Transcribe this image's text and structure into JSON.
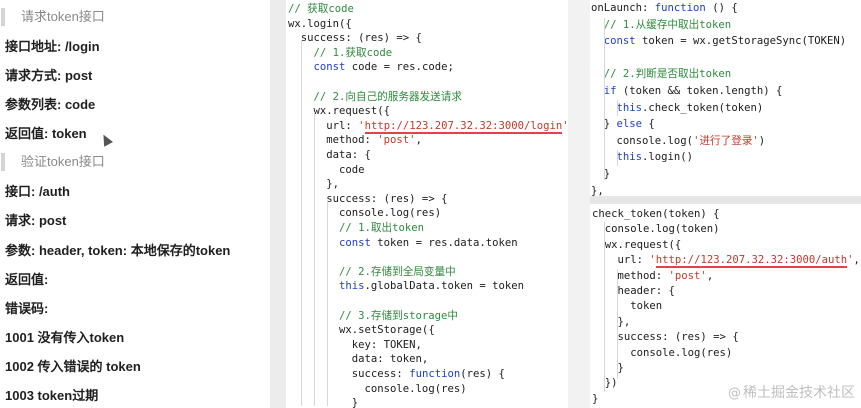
{
  "doc": {
    "lines": [
      {
        "text": "请求token接口",
        "kind": "section"
      },
      {
        "text": "接口地址: /login",
        "kind": "field"
      },
      {
        "text": "请求方式: post",
        "kind": "field"
      },
      {
        "text": "参数列表: code",
        "kind": "field"
      },
      {
        "text": "返回值: token",
        "kind": "field"
      },
      {
        "text": "验证token接口",
        "kind": "section"
      },
      {
        "text": "接口: /auth",
        "kind": "field"
      },
      {
        "text": "请求: post",
        "kind": "field"
      },
      {
        "text": "参数: header, token: 本地保存的token",
        "kind": "field"
      },
      {
        "text": "返回值:",
        "kind": "field"
      },
      {
        "text": "错误码:",
        "kind": "field"
      },
      {
        "text": "1001 没有传入token",
        "kind": "field"
      },
      {
        "text": "1002 传入错误的 token",
        "kind": "field"
      },
      {
        "text": "1003 token过期",
        "kind": "field"
      }
    ]
  },
  "code_login": {
    "lines": [
      [
        [
          "c",
          "// 获取code"
        ]
      ],
      [
        [
          "p",
          "wx.login({"
        ]
      ],
      [
        [
          "p",
          "  success: (res) => {"
        ]
      ],
      [
        [
          "c",
          "    // 1.获取code"
        ]
      ],
      [
        [
          "k",
          "    const "
        ],
        [
          "p",
          "code = res.code;"
        ]
      ],
      [
        [
          "p",
          ""
        ]
      ],
      [
        [
          "c",
          "    // 2.向自己的服务器发送请求"
        ]
      ],
      [
        [
          "p",
          "    wx.request({"
        ]
      ],
      [
        [
          "p",
          "      url: "
        ],
        [
          "s",
          "'"
        ],
        [
          "u",
          "http://123.207.32.32:3000/login"
        ],
        [
          "s",
          "'"
        ],
        [
          "p",
          ","
        ]
      ],
      [
        [
          "p",
          "      method: "
        ],
        [
          "s",
          "'post'"
        ],
        [
          "p",
          ","
        ]
      ],
      [
        [
          "p",
          "      data: {"
        ]
      ],
      [
        [
          "p",
          "        code"
        ]
      ],
      [
        [
          "p",
          "      },"
        ]
      ],
      [
        [
          "p",
          "      success: (res) => {"
        ]
      ],
      [
        [
          "p",
          "        console.log(res)"
        ]
      ],
      [
        [
          "c",
          "        // 1.取出token"
        ]
      ],
      [
        [
          "k",
          "        const "
        ],
        [
          "p",
          "token = res.data.token"
        ]
      ],
      [
        [
          "p",
          ""
        ]
      ],
      [
        [
          "c",
          "        // 2.存储到全局变量中"
        ]
      ],
      [
        [
          "k",
          "        this"
        ],
        [
          "p",
          ".globalData.token = token"
        ]
      ],
      [
        [
          "p",
          ""
        ]
      ],
      [
        [
          "c",
          "        // 3.存储到storage中"
        ]
      ],
      [
        [
          "p",
          "        wx.setStorage({"
        ]
      ],
      [
        [
          "p",
          "          key: TOKEN,"
        ]
      ],
      [
        [
          "p",
          "          data: token,"
        ]
      ],
      [
        [
          "p",
          "          success: "
        ],
        [
          "k",
          "function"
        ],
        [
          "p",
          "(res) {"
        ]
      ],
      [
        [
          "p",
          "            console.log(res)"
        ]
      ],
      [
        [
          "p",
          "          }"
        ]
      ]
    ]
  },
  "code_launch": {
    "lines": [
      [
        [
          "p",
          "onLaunch: "
        ],
        [
          "k",
          "function"
        ],
        [
          "p",
          " () {"
        ]
      ],
      [
        [
          "c",
          "  // 1.从缓存中取出token"
        ]
      ],
      [
        [
          "k",
          "  const "
        ],
        [
          "p",
          "token = wx.getStorageSync(TOKEN)"
        ]
      ],
      [
        [
          "p",
          ""
        ]
      ],
      [
        [
          "c",
          "  // 2.判断是否取出token"
        ]
      ],
      [
        [
          "k",
          "  if "
        ],
        [
          "p",
          "(token && token.length) {"
        ]
      ],
      [
        [
          "k",
          "    this"
        ],
        [
          "p",
          ".check_token(token)"
        ]
      ],
      [
        [
          "p",
          "  } "
        ],
        [
          "k",
          "else"
        ],
        [
          "p",
          " {"
        ]
      ],
      [
        [
          "p",
          "    console.log("
        ],
        [
          "s",
          "'进行了登录'"
        ],
        [
          "p",
          ")"
        ]
      ],
      [
        [
          "k",
          "    this"
        ],
        [
          "p",
          ".login()"
        ]
      ],
      [
        [
          "p",
          "  }"
        ]
      ],
      [
        [
          "p",
          "},"
        ]
      ]
    ]
  },
  "code_check": {
    "lines": [
      [
        [
          "p",
          "check_token(token) {"
        ]
      ],
      [
        [
          "p",
          "  console.log(token)"
        ]
      ],
      [
        [
          "p",
          "  wx.request({"
        ]
      ],
      [
        [
          "p",
          "    url: "
        ],
        [
          "s",
          "'"
        ],
        [
          "u",
          "http://123.207.32.32:3000/auth"
        ],
        [
          "s",
          "'"
        ],
        [
          "p",
          ","
        ]
      ],
      [
        [
          "p",
          "    method: "
        ],
        [
          "s",
          "'post'"
        ],
        [
          "p",
          ","
        ]
      ],
      [
        [
          "p",
          "    header: {"
        ]
      ],
      [
        [
          "p",
          "      token"
        ]
      ],
      [
        [
          "p",
          "    },"
        ]
      ],
      [
        [
          "p",
          "    success: (res) => {"
        ]
      ],
      [
        [
          "p",
          "      console.log(res)"
        ]
      ],
      [
        [
          "p",
          "    }"
        ]
      ],
      [
        [
          "p",
          "  })"
        ]
      ],
      [
        [
          "p",
          "}"
        ]
      ]
    ]
  },
  "watermark": {
    "at": "@",
    "text": "稀土掘金技术社区"
  },
  "colors": {
    "comment": "#2e8b3e",
    "string": "#c0392b",
    "keyword": "#1f3fbf",
    "url_underline": "#e5414b"
  }
}
